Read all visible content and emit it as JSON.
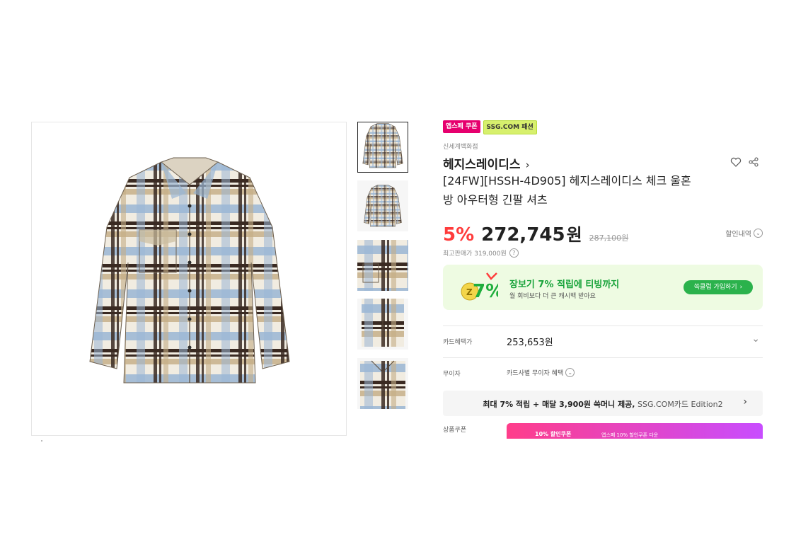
{
  "badges": {
    "coupon": "앱스페 쿠폰",
    "fashion": "SSG.COM 패션"
  },
  "store": "신세계백화점",
  "brand": {
    "name": "헤지스레이디스",
    "chevron": "›"
  },
  "product": {
    "title_line1": "[24FW][HSSH-4D905] 헤지스레이디스 체크 울혼",
    "title_line2": "방 아우터형 긴팔 셔츠"
  },
  "price": {
    "discount": "5%",
    "amount": "272,745",
    "unit": "원",
    "original": "287,100원",
    "discount_detail": "할인내역",
    "lowest": "최고판매가 319,000원"
  },
  "promo": {
    "head": "장보기 7% 적립에 티빙까지",
    "sub": "월 회비보다 더 큰 캐시백 받아요",
    "button": "쓱클럽 가입하기",
    "button_arrow": "›",
    "graphic_text": "7%"
  },
  "card": {
    "label": "카드혜택가",
    "value": "253,653원",
    "chevron": "⌄"
  },
  "interest": {
    "label": "무이자",
    "value": "카드사별 무이자 혜택"
  },
  "card_banner": {
    "strong": "최대 7% 적립 + 매달 3,900원 쓱머니 제공,",
    "muted": " SSG.COM카드 Edition2",
    "chevron": "›"
  },
  "coupon": {
    "label": "상품쿠폰",
    "text1": "10% 할인쿠폰",
    "text2": "앱스페 10% 할인쿠폰 다운"
  }
}
